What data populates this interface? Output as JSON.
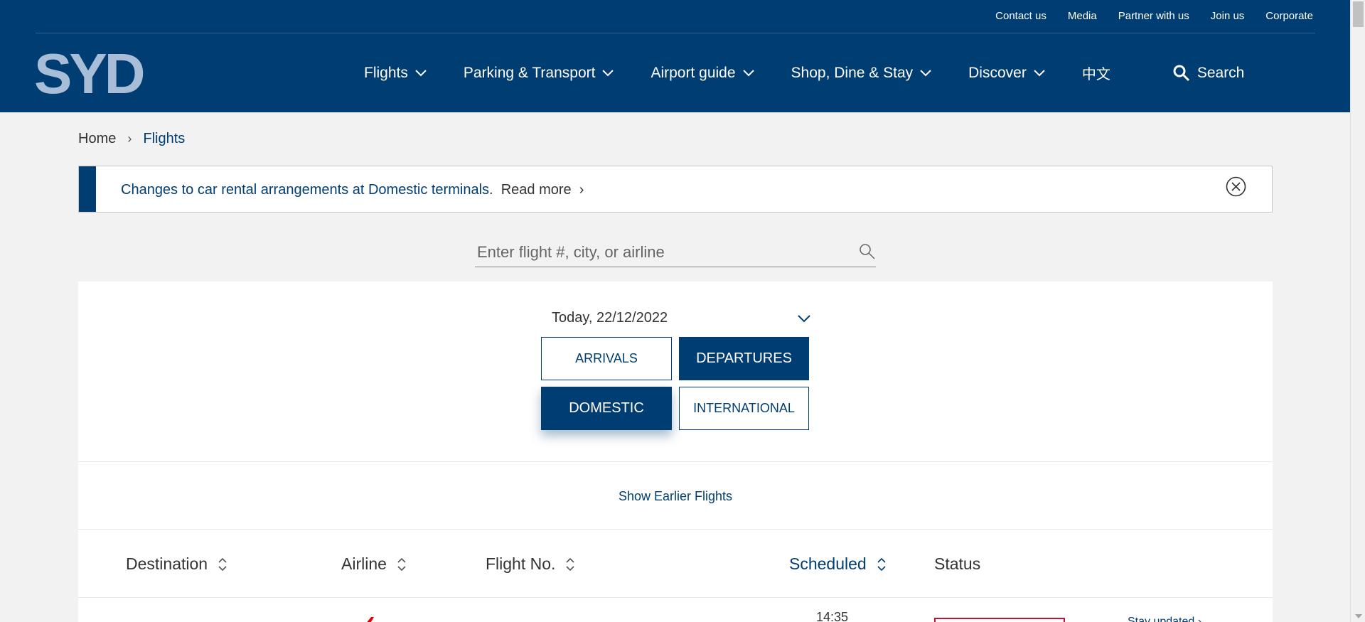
{
  "header": {
    "logo_text": "SYD",
    "util_links": [
      "Contact us",
      "Media",
      "Partner with us",
      "Join us",
      "Corporate"
    ],
    "nav": [
      {
        "label": "Flights",
        "has_menu": true
      },
      {
        "label": "Parking & Transport",
        "has_menu": true
      },
      {
        "label": "Airport guide",
        "has_menu": true
      },
      {
        "label": "Shop, Dine & Stay",
        "has_menu": true
      },
      {
        "label": "Discover",
        "has_menu": true
      }
    ],
    "language": "中文",
    "search_label": "Search"
  },
  "breadcrumb": {
    "home": "Home",
    "current": "Flights"
  },
  "alert": {
    "message": "Changes to car rental arrangements at Domestic terminals.",
    "link": "Read more"
  },
  "flight_search": {
    "placeholder": "Enter flight #, city, or airline"
  },
  "filters": {
    "date": "Today, 22/12/2022",
    "direction": {
      "arrivals": "ARRIVALS",
      "departures": "DEPARTURES",
      "selected": "DEPARTURES"
    },
    "type": {
      "domestic": "DOMESTIC",
      "international": "INTERNATIONAL",
      "selected": "DOMESTIC"
    }
  },
  "show_earlier": "Show Earlier Flights",
  "table": {
    "columns": [
      "Destination",
      "Airline",
      "Flight No.",
      "Scheduled",
      "Status"
    ],
    "rows": [
      {
        "scheduled": "14:35",
        "action": "Stay updated"
      }
    ]
  },
  "colors": {
    "brand_navy": "#003d73",
    "logo_light": "#a7bdd8",
    "status_red": "#c8102e",
    "page_bg": "#f2f2f2"
  }
}
